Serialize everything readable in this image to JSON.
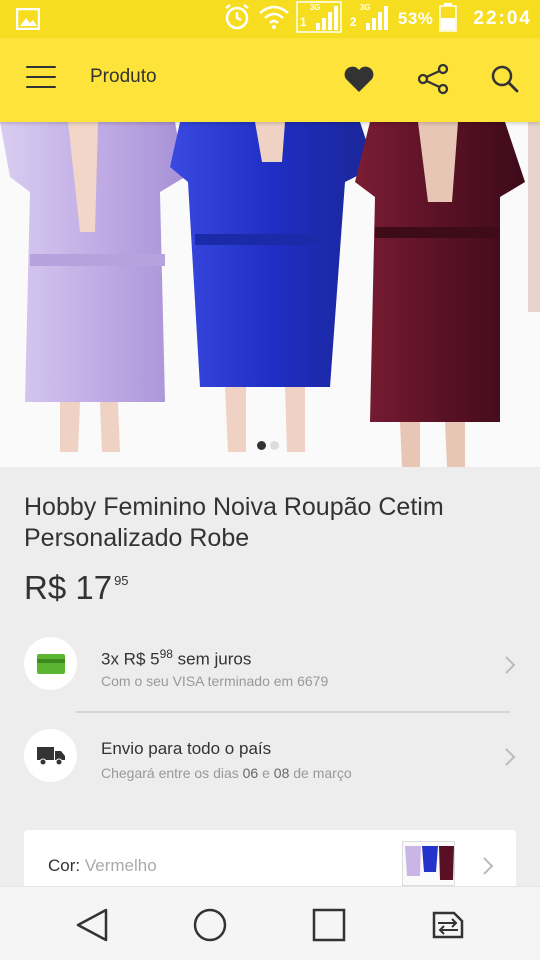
{
  "status_bar": {
    "battery_text": "53%",
    "time": "22:04",
    "network": [
      "3G",
      "3G"
    ],
    "sim_labels": [
      "1",
      "2"
    ],
    "icons": [
      "gallery-icon",
      "alarm-icon",
      "wifi-icon",
      "signal-icon",
      "battery-icon"
    ]
  },
  "header": {
    "title": "Produto",
    "icons": [
      "menu-icon",
      "heart-icon",
      "share-icon",
      "search-icon"
    ]
  },
  "gallery": {
    "current_page": 1,
    "page_count": 2,
    "robe_colors": [
      "#c9b6e6",
      "#2433c9",
      "#5a1024"
    ]
  },
  "product": {
    "title": "Hobby Feminino Noiva Roupão Cetim Personalizado Robe",
    "price_prefix": "R$ 17",
    "price_cents": "95"
  },
  "payment": {
    "installments": "3x R$ 5",
    "installment_cents": "98",
    "suffix": " sem juros",
    "card_text": "Com o seu VISA terminado em 6679"
  },
  "shipping": {
    "title": "Envio para todo o país",
    "text_prefix": "Chegará entre os dias ",
    "date_from": "06",
    "text_mid": " e ",
    "date_to": "08",
    "text_suffix": " de março"
  },
  "variation": {
    "label": "Cor:",
    "value": "Vermelho"
  },
  "colors": {
    "status_bar": "#f7dd1f",
    "header": "#fde33a",
    "card_green": "#5cb531",
    "dot_active": "#333333",
    "dot_inactive": "#dddddd"
  },
  "nav_bar": {
    "icons": [
      "back-icon",
      "home-icon",
      "recents-icon",
      "switch-sim-icon"
    ]
  }
}
